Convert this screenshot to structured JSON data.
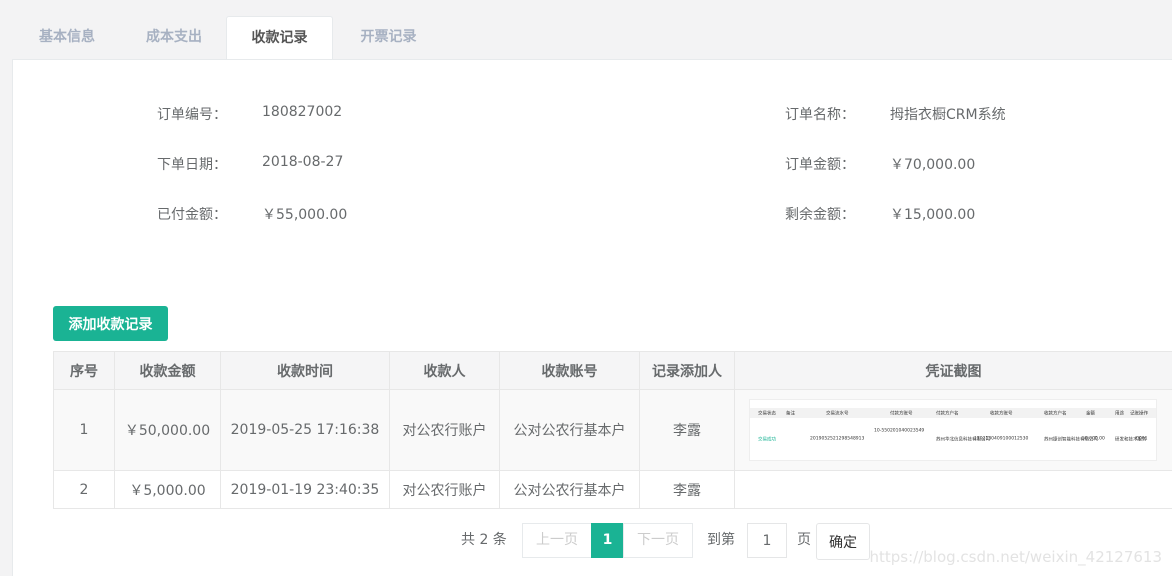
{
  "tabs": [
    {
      "label": "基本信息"
    },
    {
      "label": "成本支出"
    },
    {
      "label": "收款记录"
    },
    {
      "label": "开票记录"
    }
  ],
  "order": {
    "no_label": "订单编号：",
    "no_value": "180827002",
    "name_label": "订单名称：",
    "name_value": "拇指衣橱CRM系统",
    "date_label": "下单日期：",
    "date_value": "2018-08-27",
    "amount_label": "订单金额：",
    "amount_value": "￥70,000.00",
    "paid_label": "已付金额：",
    "paid_value": "￥55,000.00",
    "remain_label": "剩余金额：",
    "remain_value": "￥15,000.00"
  },
  "add_button": "添加收款记录",
  "table": {
    "headers": [
      "序号",
      "收款金额",
      "收款时间",
      "收款人",
      "收款账号",
      "记录添加人",
      "凭证截图"
    ],
    "rows": [
      [
        "1",
        "￥50,000.00",
        "2019-05-25 17:16:38",
        "对公农行账户",
        "公对公农行基本户",
        "李露"
      ],
      [
        "2",
        "￥5,000.00",
        "2019-01-19 23:40:35",
        "对公农行账户",
        "公对公农行基本户",
        "李露"
      ]
    ]
  },
  "voucher": {
    "headers": [
      "交易状态",
      "备注",
      "交易流水号",
      "付款方账号",
      "付款方户名",
      "收款方账号",
      "收款方户名",
      "金额",
      "用途",
      "记账操作"
    ],
    "row": [
      "交易成功",
      "",
      "20190525212985489​13",
      "10-550201040023549",
      "苏州华北信息科技有限公司",
      "110213040910001253​0",
      "苏州捷创智能科技有限公司",
      "50,000.00",
      "研发和技术服务",
      "0001"
    ]
  },
  "pager": {
    "total": "共 2 条",
    "prev": "上一页",
    "current": "1",
    "next": "下一页",
    "goto": "到第",
    "page_value": "1",
    "page_unit": "页",
    "confirm": "确定"
  },
  "watermark": "https://blog.csdn.net/weixin_42127613",
  "colors": {
    "accent": "#1ab394",
    "text": "#676a6c",
    "muted_tab": "#a7b1c2"
  }
}
